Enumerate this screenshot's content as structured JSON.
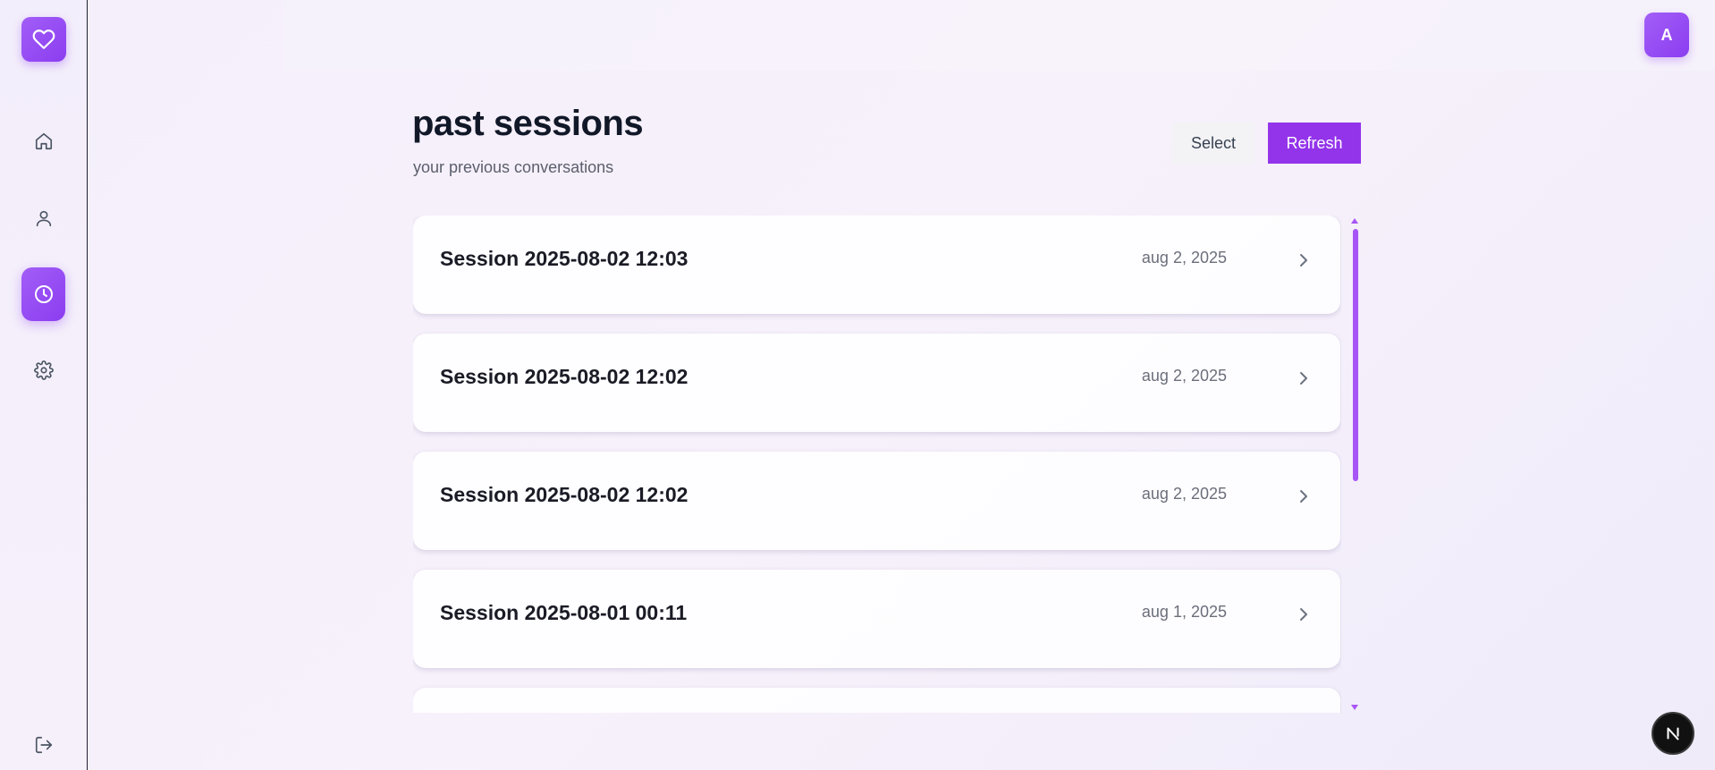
{
  "sidebar": {
    "logo_icon": "heart-icon",
    "items": [
      {
        "name": "home",
        "icon": "home-icon",
        "active": false
      },
      {
        "name": "profile",
        "icon": "user-icon",
        "active": false
      },
      {
        "name": "history",
        "icon": "clock-icon",
        "active": true
      },
      {
        "name": "settings",
        "icon": "gear-icon",
        "active": false
      }
    ],
    "logout_icon": "logout-icon"
  },
  "header": {
    "avatar_initial": "A"
  },
  "page": {
    "title": "past sessions",
    "subtitle": "your previous conversations",
    "select_label": "Select",
    "refresh_label": "Refresh"
  },
  "sessions": [
    {
      "title": "Session 2025-08-02 12:03",
      "date": "aug 2, 2025"
    },
    {
      "title": "Session 2025-08-02 12:02",
      "date": "aug 2, 2025"
    },
    {
      "title": "Session 2025-08-02 12:02",
      "date": "aug 2, 2025"
    },
    {
      "title": "Session 2025-08-01 00:11",
      "date": "aug 1, 2025"
    },
    {
      "title": "",
      "date": ""
    }
  ],
  "colors": {
    "accent": "#9333ea",
    "accent_gradient_start": "#a25ef7",
    "accent_gradient_end": "#8b3df0",
    "scrollbar": "#a855f7"
  },
  "badge": {
    "label": "N"
  }
}
